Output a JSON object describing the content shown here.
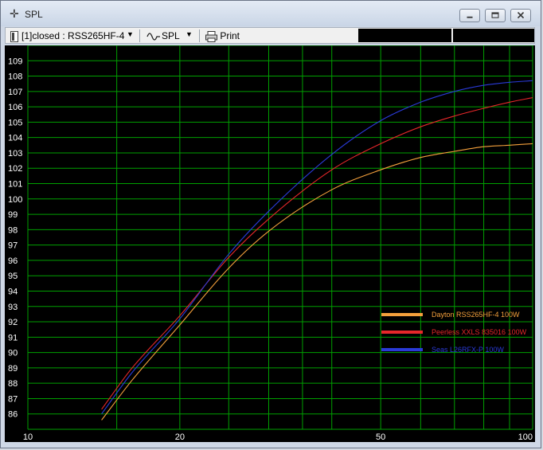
{
  "window": {
    "title": "SPL",
    "controls": [
      "minimize",
      "maximize",
      "close"
    ]
  },
  "toolbar": {
    "project_label": "[1]closed : RSS265HF-4",
    "view_label": "SPL",
    "print_label": "Print",
    "icons": {
      "project": "document-icon",
      "view": "waveform-icon",
      "print": "printer-icon"
    }
  },
  "colors": {
    "plot_background": "#000000",
    "grid": "#00a000",
    "dayton": "#f4a03c",
    "peerless": "#e8272a",
    "seas": "#2a3ad8"
  },
  "chart_data": {
    "type": "line",
    "xscale": "log",
    "xlim": [
      10,
      100
    ],
    "ylim": [
      85,
      110
    ],
    "grid": true,
    "legend_position": "bottom-right",
    "x_ticks": [
      10,
      20,
      50,
      100
    ],
    "y_ticks": [
      86,
      87,
      88,
      89,
      90,
      91,
      92,
      93,
      94,
      95,
      96,
      97,
      98,
      99,
      100,
      101,
      102,
      103,
      104,
      105,
      106,
      107,
      108,
      109
    ],
    "series": [
      {
        "name": "Dayton RSS265HF-4 100W",
        "color": "#f4a03c",
        "x": [
          14,
          16,
          20,
          25,
          30,
          40,
          50,
          60,
          70,
          80,
          90,
          100
        ],
        "y": [
          85.6,
          88.1,
          91.8,
          95.5,
          97.9,
          100.6,
          101.9,
          102.7,
          103.1,
          103.4,
          103.5,
          103.6
        ]
      },
      {
        "name": "Peerless XXLS 835016 100W",
        "color": "#e8272a",
        "x": [
          14,
          16,
          20,
          25,
          30,
          40,
          50,
          60,
          70,
          80,
          90,
          100
        ],
        "y": [
          86.3,
          88.9,
          92.4,
          96.2,
          98.7,
          101.9,
          103.6,
          104.7,
          105.4,
          105.9,
          106.3,
          106.6
        ]
      },
      {
        "name": "Seas L26RFX-P 100W",
        "color": "#2a3ad8",
        "x": [
          14,
          16,
          20,
          25,
          30,
          40,
          50,
          60,
          70,
          80,
          90,
          100
        ],
        "y": [
          86.0,
          88.6,
          92.2,
          96.4,
          99.2,
          102.9,
          105.1,
          106.3,
          107.0,
          107.4,
          107.6,
          107.7
        ]
      }
    ]
  }
}
